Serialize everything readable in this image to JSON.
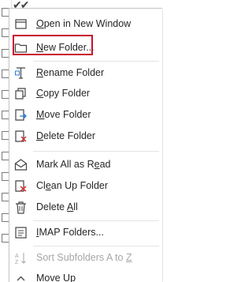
{
  "top_strip": {
    "checkmarks": "✔✔"
  },
  "menu": {
    "items": [
      {
        "key": "open_new_window",
        "pre": "",
        "u": "O",
        "post": "pen in New Window",
        "icon": "window-icon",
        "disabled": false
      },
      {
        "key": "new_folder",
        "pre": "",
        "u": "N",
        "post": "ew Folder...",
        "icon": "folder-icon",
        "disabled": false
      },
      {
        "key": "rename_folder",
        "pre": "",
        "u": "R",
        "post": "ename Folder",
        "icon": "rename-icon",
        "disabled": false
      },
      {
        "key": "copy_folder",
        "pre": "",
        "u": "C",
        "post": "opy Folder",
        "icon": "copy-folder-icon",
        "disabled": false
      },
      {
        "key": "move_folder",
        "pre": "",
        "u": "M",
        "post": "ove Folder",
        "icon": "move-folder-icon",
        "disabled": false
      },
      {
        "key": "delete_folder",
        "pre": "",
        "u": "D",
        "post": "elete Folder",
        "icon": "delete-folder-icon",
        "disabled": false
      },
      {
        "key": "mark_all_read",
        "pre": "Mark All as R",
        "u": "e",
        "post": "ad",
        "icon": "envelope-open-icon",
        "disabled": false
      },
      {
        "key": "clean_up_folder",
        "pre": "Cl",
        "u": "e",
        "post": "an Up Folder",
        "icon": "clean-up-icon",
        "disabled": false
      },
      {
        "key": "delete_all",
        "pre": "Delete ",
        "u": "A",
        "post": "ll",
        "icon": "trash-icon",
        "disabled": false
      },
      {
        "key": "imap_folders",
        "pre": "",
        "u": "I",
        "post": "MAP Folders...",
        "icon": "imap-folders-icon",
        "disabled": false
      },
      {
        "key": "sort_subfolders",
        "pre": "Sort Subfolders A to ",
        "u": "Z",
        "post": "",
        "icon": "sort-az-icon",
        "disabled": true
      },
      {
        "key": "move_up",
        "pre": "Move ",
        "u": "U",
        "post": "p",
        "icon": "chevron-up-icon",
        "disabled": false
      }
    ]
  },
  "colors": {
    "highlight_border": "#c8102e",
    "text": "#262626",
    "disabled_text": "#a6a6a6"
  }
}
